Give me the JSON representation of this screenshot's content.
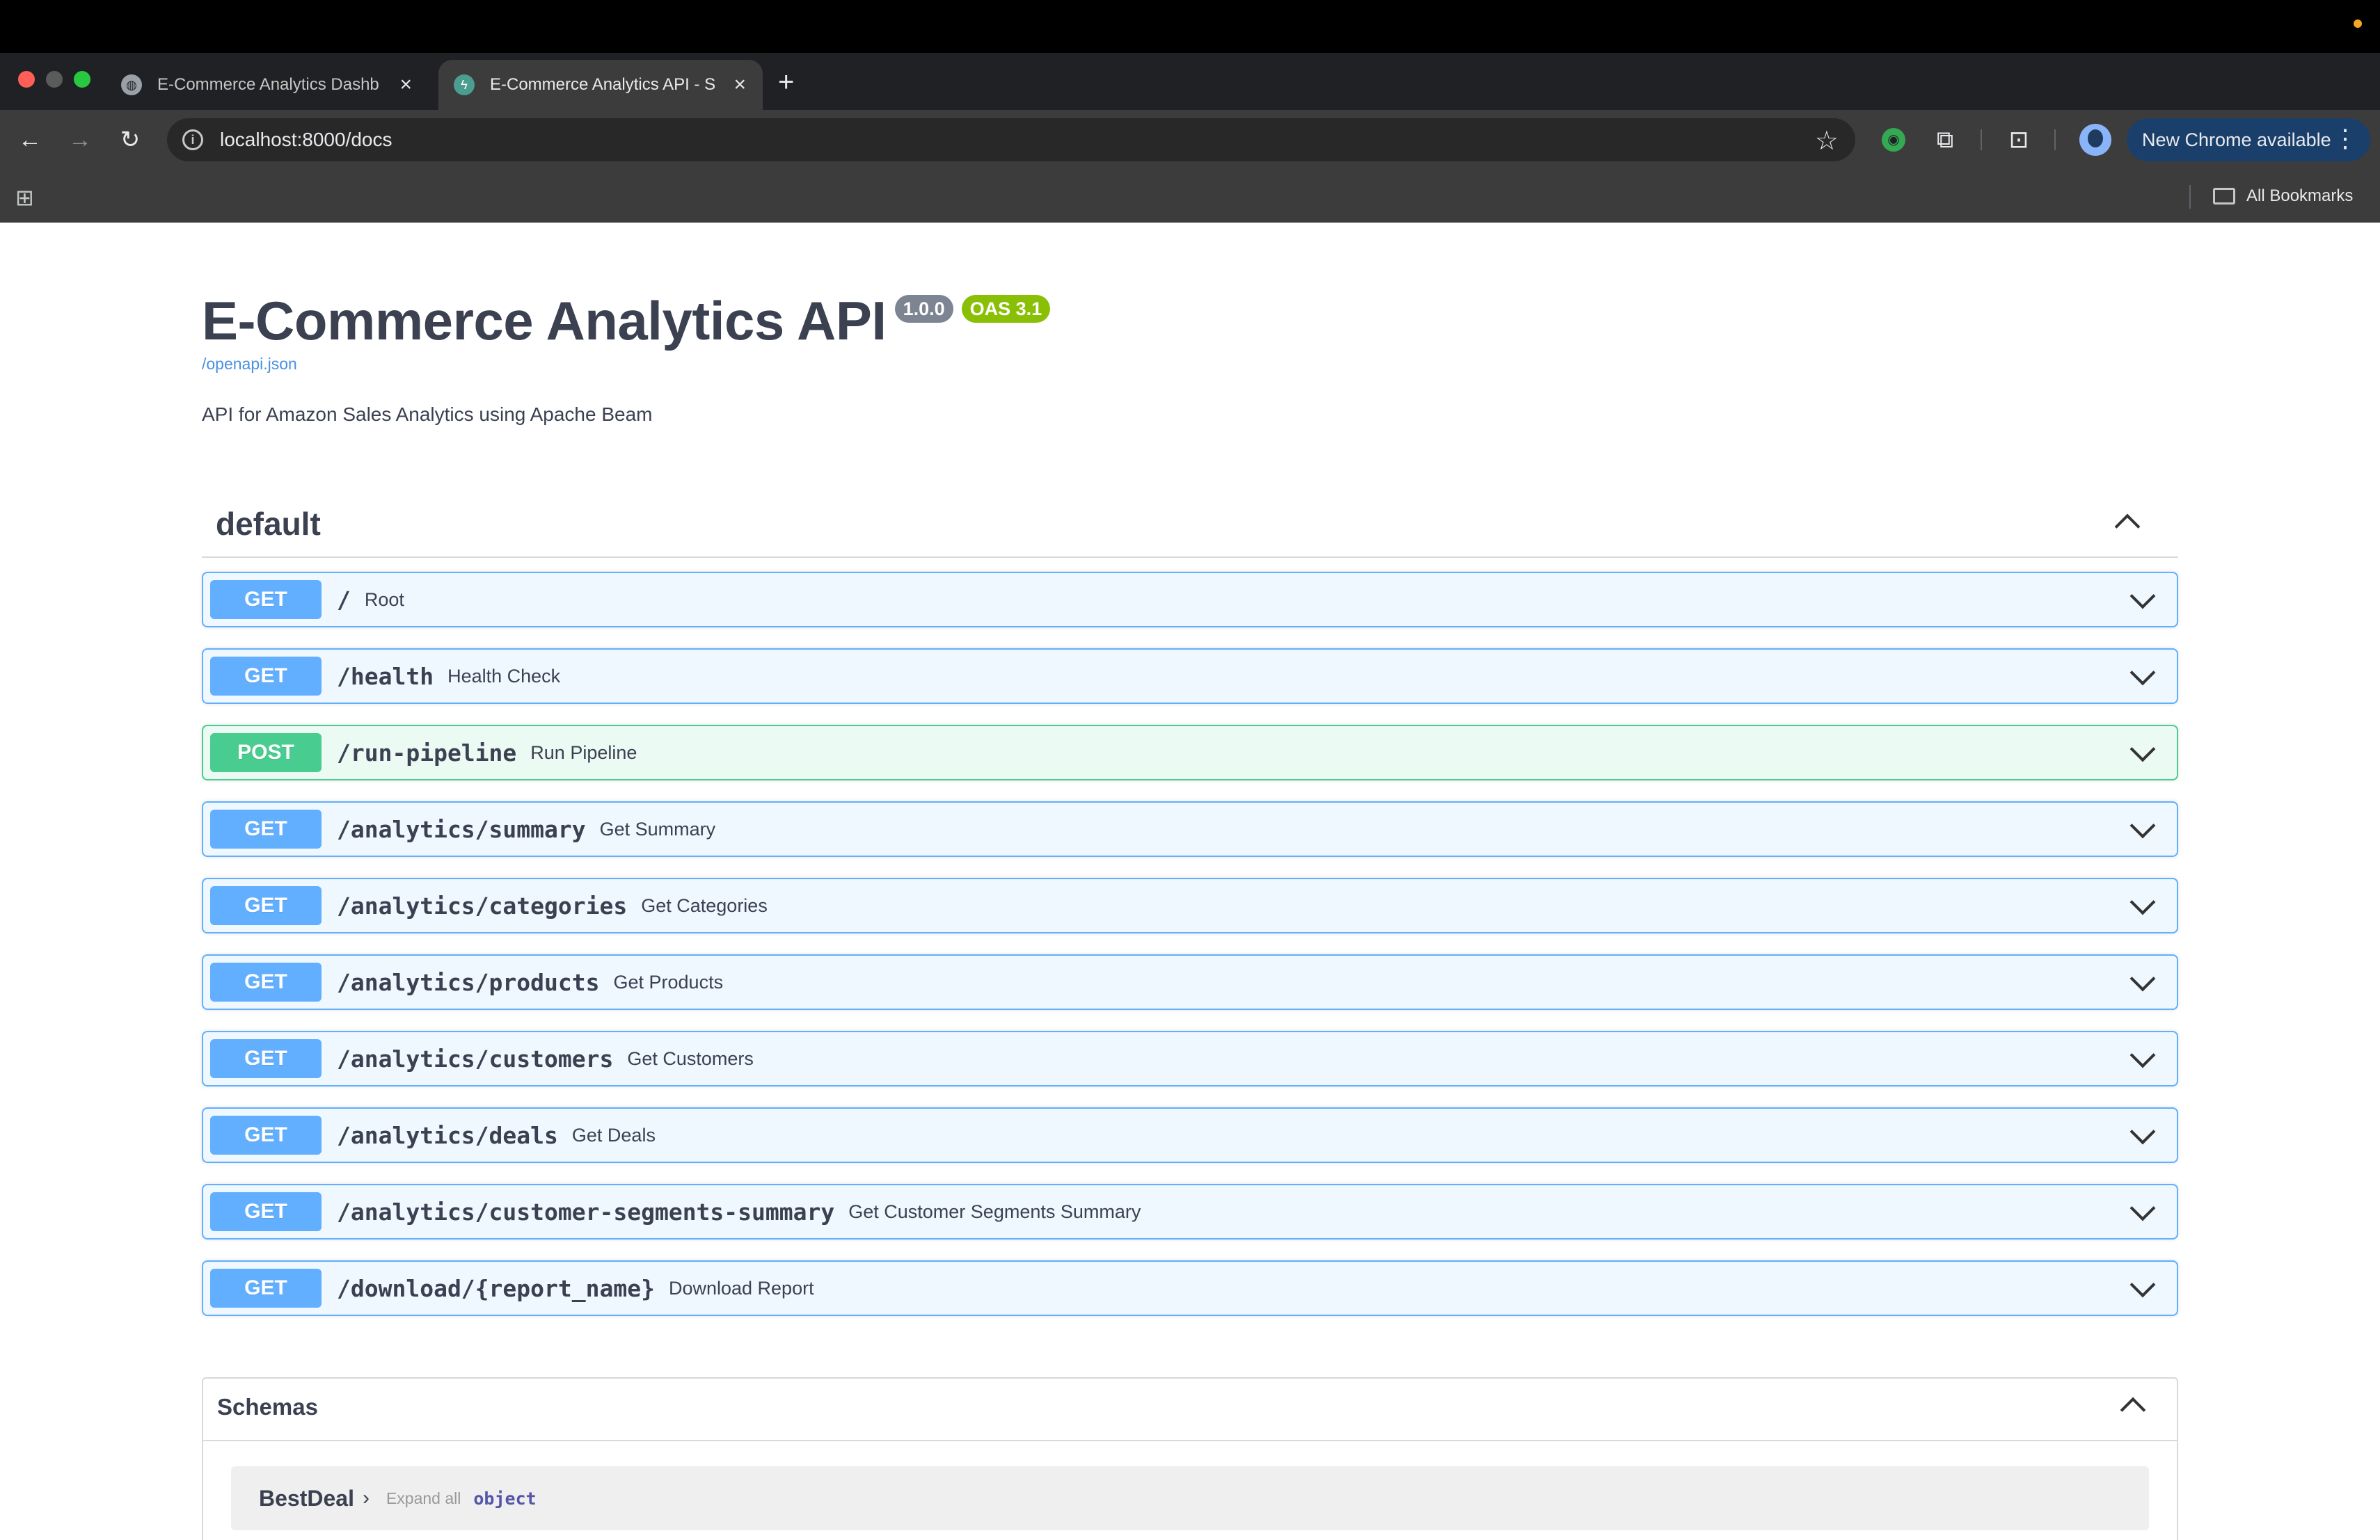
{
  "browser": {
    "tabs": [
      {
        "title": "E-Commerce Analytics Dashb",
        "active": false
      },
      {
        "title": "E-Commerce Analytics API - S",
        "active": true
      }
    ],
    "url": "localhost:8000/docs",
    "update_button": "New Chrome available",
    "bookmarks_label": "All Bookmarks"
  },
  "api": {
    "title": "E-Commerce Analytics API",
    "version": "1.0.0",
    "oas": "OAS 3.1",
    "spec_link": "/openapi.json",
    "description": "API for Amazon Sales Analytics using Apache Beam"
  },
  "tag": {
    "name": "default",
    "operations": [
      {
        "method": "GET",
        "path": "/",
        "summary": "Root"
      },
      {
        "method": "GET",
        "path": "/health",
        "summary": "Health Check"
      },
      {
        "method": "POST",
        "path": "/run-pipeline",
        "summary": "Run Pipeline"
      },
      {
        "method": "GET",
        "path": "/analytics/summary",
        "summary": "Get Summary"
      },
      {
        "method": "GET",
        "path": "/analytics/categories",
        "summary": "Get Categories"
      },
      {
        "method": "GET",
        "path": "/analytics/products",
        "summary": "Get Products"
      },
      {
        "method": "GET",
        "path": "/analytics/customers",
        "summary": "Get Customers"
      },
      {
        "method": "GET",
        "path": "/analytics/deals",
        "summary": "Get Deals"
      },
      {
        "method": "GET",
        "path": "/analytics/customer-segments-summary",
        "summary": "Get Customer Segments Summary"
      },
      {
        "method": "GET",
        "path": "/download/{report_name}",
        "summary": "Download Report"
      }
    ]
  },
  "schemas": {
    "title": "Schemas",
    "models": [
      {
        "name": "BestDeal",
        "expand_label": "Expand all",
        "type": "object"
      }
    ]
  }
}
